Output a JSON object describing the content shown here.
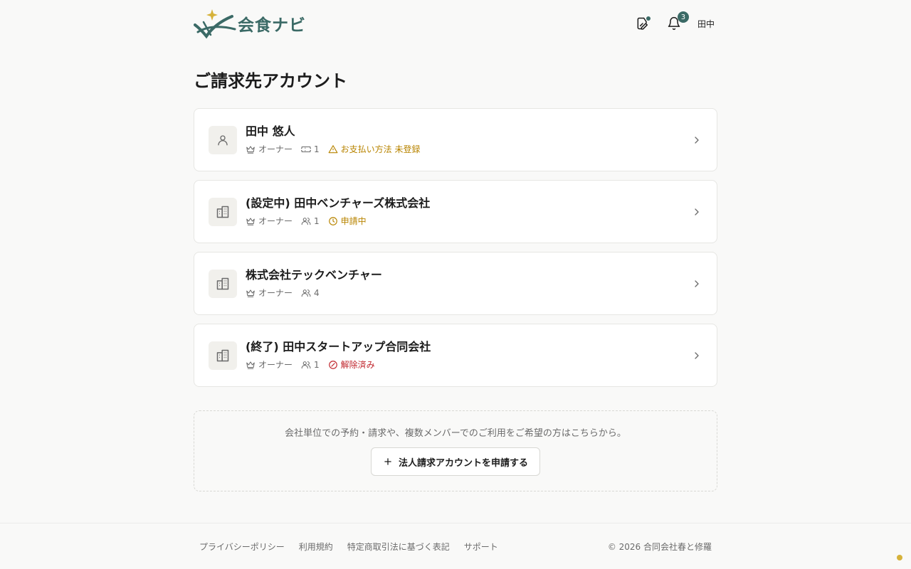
{
  "header": {
    "logo_text": "会食ナビ",
    "notification_count": "3",
    "user_label": "田中"
  },
  "page_title": "ご請求先アカウント",
  "accounts": [
    {
      "name": "田中 悠人",
      "role": "オーナー",
      "count": "1",
      "status": "お支払い方法 未登録"
    },
    {
      "name": "(設定中) 田中ベンチャーズ株式会社",
      "role": "オーナー",
      "count": "1",
      "status": "申請中"
    },
    {
      "name": "株式会社テックベンチャー",
      "role": "オーナー",
      "count": "4"
    },
    {
      "name": "(終了) 田中スタートアップ合同会社",
      "role": "オーナー",
      "count": "1",
      "status": "解除済み"
    }
  ],
  "cta": {
    "text": "会社単位での予約・請求や、複数メンバーでのご利用をご希望の方はこちらから。",
    "button_label": "法人請求アカウントを申請する"
  },
  "footer": {
    "links": [
      "プライバシーポリシー",
      "利用規約",
      "特定商取引法に基づく表記",
      "サポート"
    ],
    "copyright": "© 2026 合同会社春と修羅"
  },
  "colors": {
    "brand": "#3b6a66",
    "warning": "#b88400",
    "danger": "#c0262d",
    "accent_gold": "#d6b23a"
  }
}
